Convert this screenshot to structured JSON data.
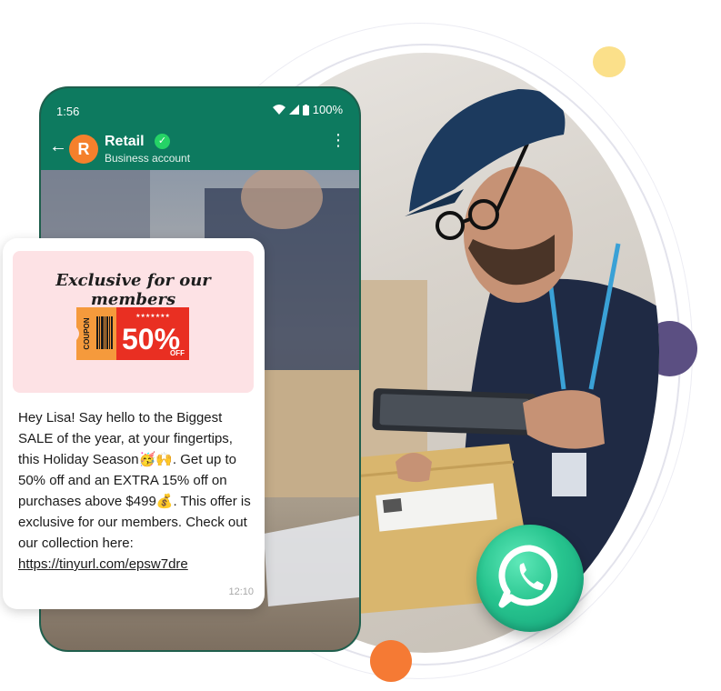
{
  "status": {
    "time": "1:56",
    "battery": "100%"
  },
  "chat": {
    "avatar_letter": "R",
    "name": "Retail",
    "subtitle": "Business account"
  },
  "banner": {
    "title": "Exclusive for our members",
    "coupon_word": "COUPON",
    "discount": "50%",
    "off": "OFF"
  },
  "message": {
    "body": "Hey Lisa! Say hello to the Biggest SALE of the year, at your fingertips, this Holiday Season🥳🙌. Get up to 50% off and an EXTRA 15% off on purchases above $499💰. This offer is exclusive for our members. Check out our collection here:",
    "link": "https://tinyurl.com/epsw7dre",
    "time": "12:10"
  },
  "colors": {
    "header_green": "#0d7a5f",
    "avatar_orange": "#f5802c",
    "banner_pink": "#fde2e5",
    "coupon_red": "#ec2a26",
    "whatsapp_green": "#25d366"
  },
  "icons": [
    "back-arrow-icon",
    "verified-icon",
    "more-vert-icon",
    "wifi-icon",
    "signal-icon",
    "battery-icon",
    "whatsapp-icon"
  ]
}
